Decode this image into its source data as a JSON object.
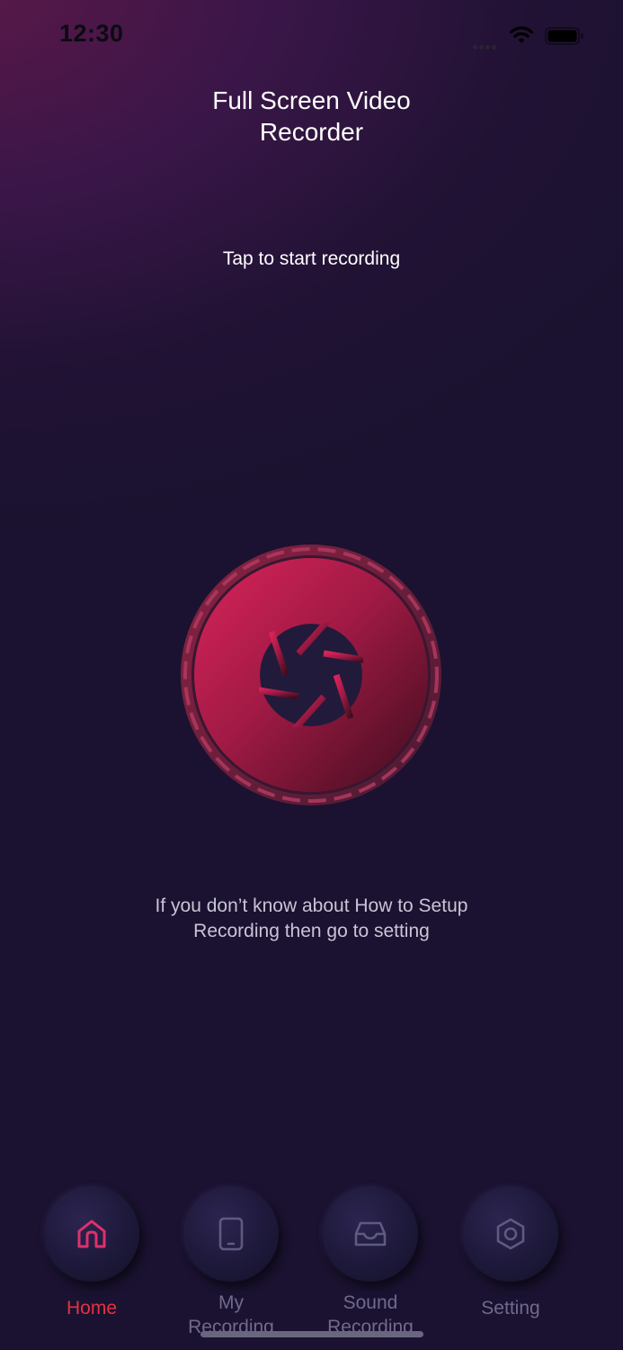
{
  "status_bar": {
    "time": "12:30"
  },
  "header": {
    "title_line1": "Full Screen Video",
    "title_line2": "Recorder"
  },
  "main": {
    "hint": "Tap to start recording",
    "info_line1": "If you don’t know about How to Setup",
    "info_line2": "Recording then go to setting"
  },
  "tabs": [
    {
      "label": "Home",
      "icon": "home-icon",
      "active": true
    },
    {
      "label_line1": "My",
      "label_line2": "Recording",
      "icon": "phone-icon",
      "active": false
    },
    {
      "label_line1": "Sound",
      "label_line2": "Recording",
      "icon": "inbox-icon",
      "active": false
    },
    {
      "label": "Setting",
      "icon": "gear-icon",
      "active": false
    }
  ],
  "colors": {
    "accent": "#e53240",
    "record_button": "#c2204e",
    "background": "#1a1230"
  }
}
